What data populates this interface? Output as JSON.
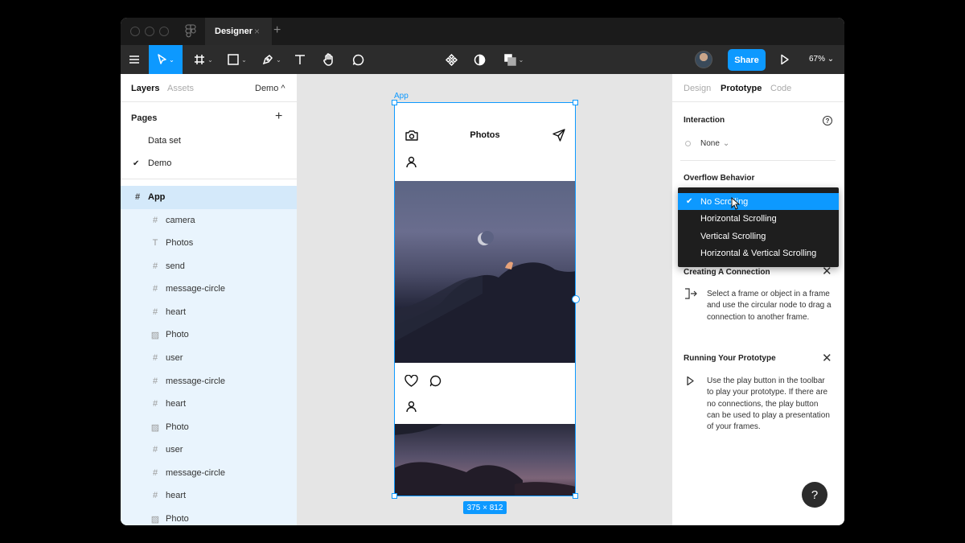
{
  "titlebar": {
    "tab_label": "Designer",
    "tab_close": "×",
    "tab_add": "+"
  },
  "toolbar": {
    "share_label": "Share",
    "zoom_label": "67%",
    "zoom_chevron": "⌄"
  },
  "left_panel": {
    "tabs": {
      "layers": "Layers",
      "assets": "Assets",
      "page_selector": "Demo ^"
    },
    "pages_title": "Pages",
    "pages_add": "+",
    "pages": [
      {
        "label": "Data set"
      },
      {
        "label": "Demo",
        "check": "✔"
      }
    ],
    "layers": [
      {
        "label": "App",
        "icon": "#"
      },
      {
        "label": "camera",
        "icon": "#"
      },
      {
        "label": "Photos",
        "icon": "T"
      },
      {
        "label": "send",
        "icon": "#"
      },
      {
        "label": "message-circle",
        "icon": "#"
      },
      {
        "label": "heart",
        "icon": "#"
      },
      {
        "label": "Photo",
        "icon": "▨"
      },
      {
        "label": "user",
        "icon": "#"
      },
      {
        "label": "message-circle",
        "icon": "#"
      },
      {
        "label": "heart",
        "icon": "#"
      },
      {
        "label": "Photo",
        "icon": "▨"
      },
      {
        "label": "user",
        "icon": "#"
      },
      {
        "label": "message-circle",
        "icon": "#"
      },
      {
        "label": "heart",
        "icon": "#"
      },
      {
        "label": "Photo",
        "icon": "▨"
      }
    ]
  },
  "canvas": {
    "frame_label": "App",
    "phone_title": "Photos",
    "size_badge": "375 × 812"
  },
  "right_panel": {
    "tabs": {
      "design": "Design",
      "prototype": "Prototype",
      "code": "Code"
    },
    "interaction_title": "Interaction",
    "help_glyph": "?",
    "interaction_value": "None",
    "interaction_chevron": "⌄",
    "overflow_title": "Overflow Behavior",
    "overflow_options": [
      {
        "label": "No Scrolling",
        "selected": true,
        "check": "✔"
      },
      {
        "label": "Horizontal Scrolling"
      },
      {
        "label": "Vertical Scrolling"
      },
      {
        "label": "Horizontal & Vertical Scrolling"
      }
    ],
    "creating_title": "Creating A Connection",
    "creating_text": "Select a frame or object in a frame and use the circular node to drag a connection to another frame.",
    "running_title": "Running Your Prototype",
    "running_text": "Use the play button in the toolbar to play your prototype. If there are no connections, the play button can be used to play a presentation of your frames.",
    "close_glyph": "✕",
    "help_fab": "?"
  },
  "colors": {
    "accent": "#0d99ff",
    "toolbar_bg": "#2c2c2c",
    "titlebar_bg": "#1b1b1b",
    "layer_highlight": "#e9f4fd"
  }
}
